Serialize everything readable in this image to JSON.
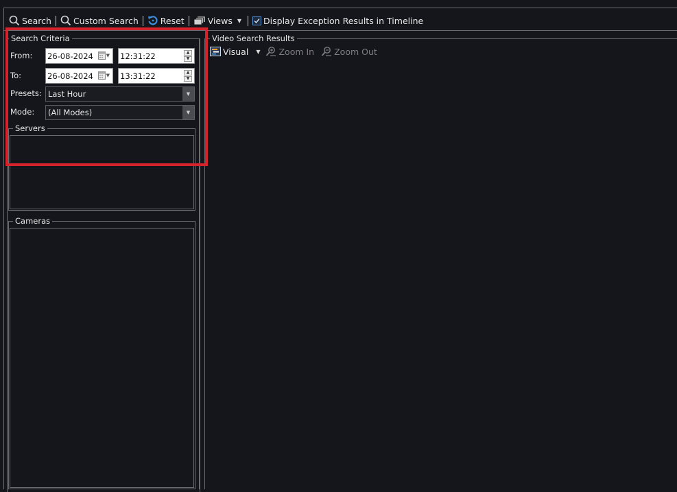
{
  "toolbar": {
    "search_label": "Search",
    "custom_search_label": "Custom Search",
    "reset_label": "Reset",
    "views_label": "Views",
    "display_exceptions_label": "Display Exception Results in Timeline",
    "display_exceptions_checked": true
  },
  "search_criteria": {
    "title": "Search Criteria",
    "from_label": "From:",
    "from_date": "26-08-2024",
    "from_time": "12:31:22",
    "to_label": "To:",
    "to_date": "26-08-2024",
    "to_time": "13:31:22",
    "presets_label": "Presets:",
    "presets_value": "Last Hour",
    "mode_label": "Mode:",
    "mode_value": "(All Modes)"
  },
  "servers": {
    "title": "Servers",
    "items": []
  },
  "cameras": {
    "title": "Cameras",
    "items": []
  },
  "video_results": {
    "title": "Video Search Results",
    "visual_label": "Visual",
    "zoom_in_label": "Zoom In",
    "zoom_out_label": "Zoom Out"
  },
  "colors": {
    "background": "#15161b",
    "highlight": "#d4232b",
    "border": "#6b6b70",
    "disabled_text": "#7d7d82"
  }
}
